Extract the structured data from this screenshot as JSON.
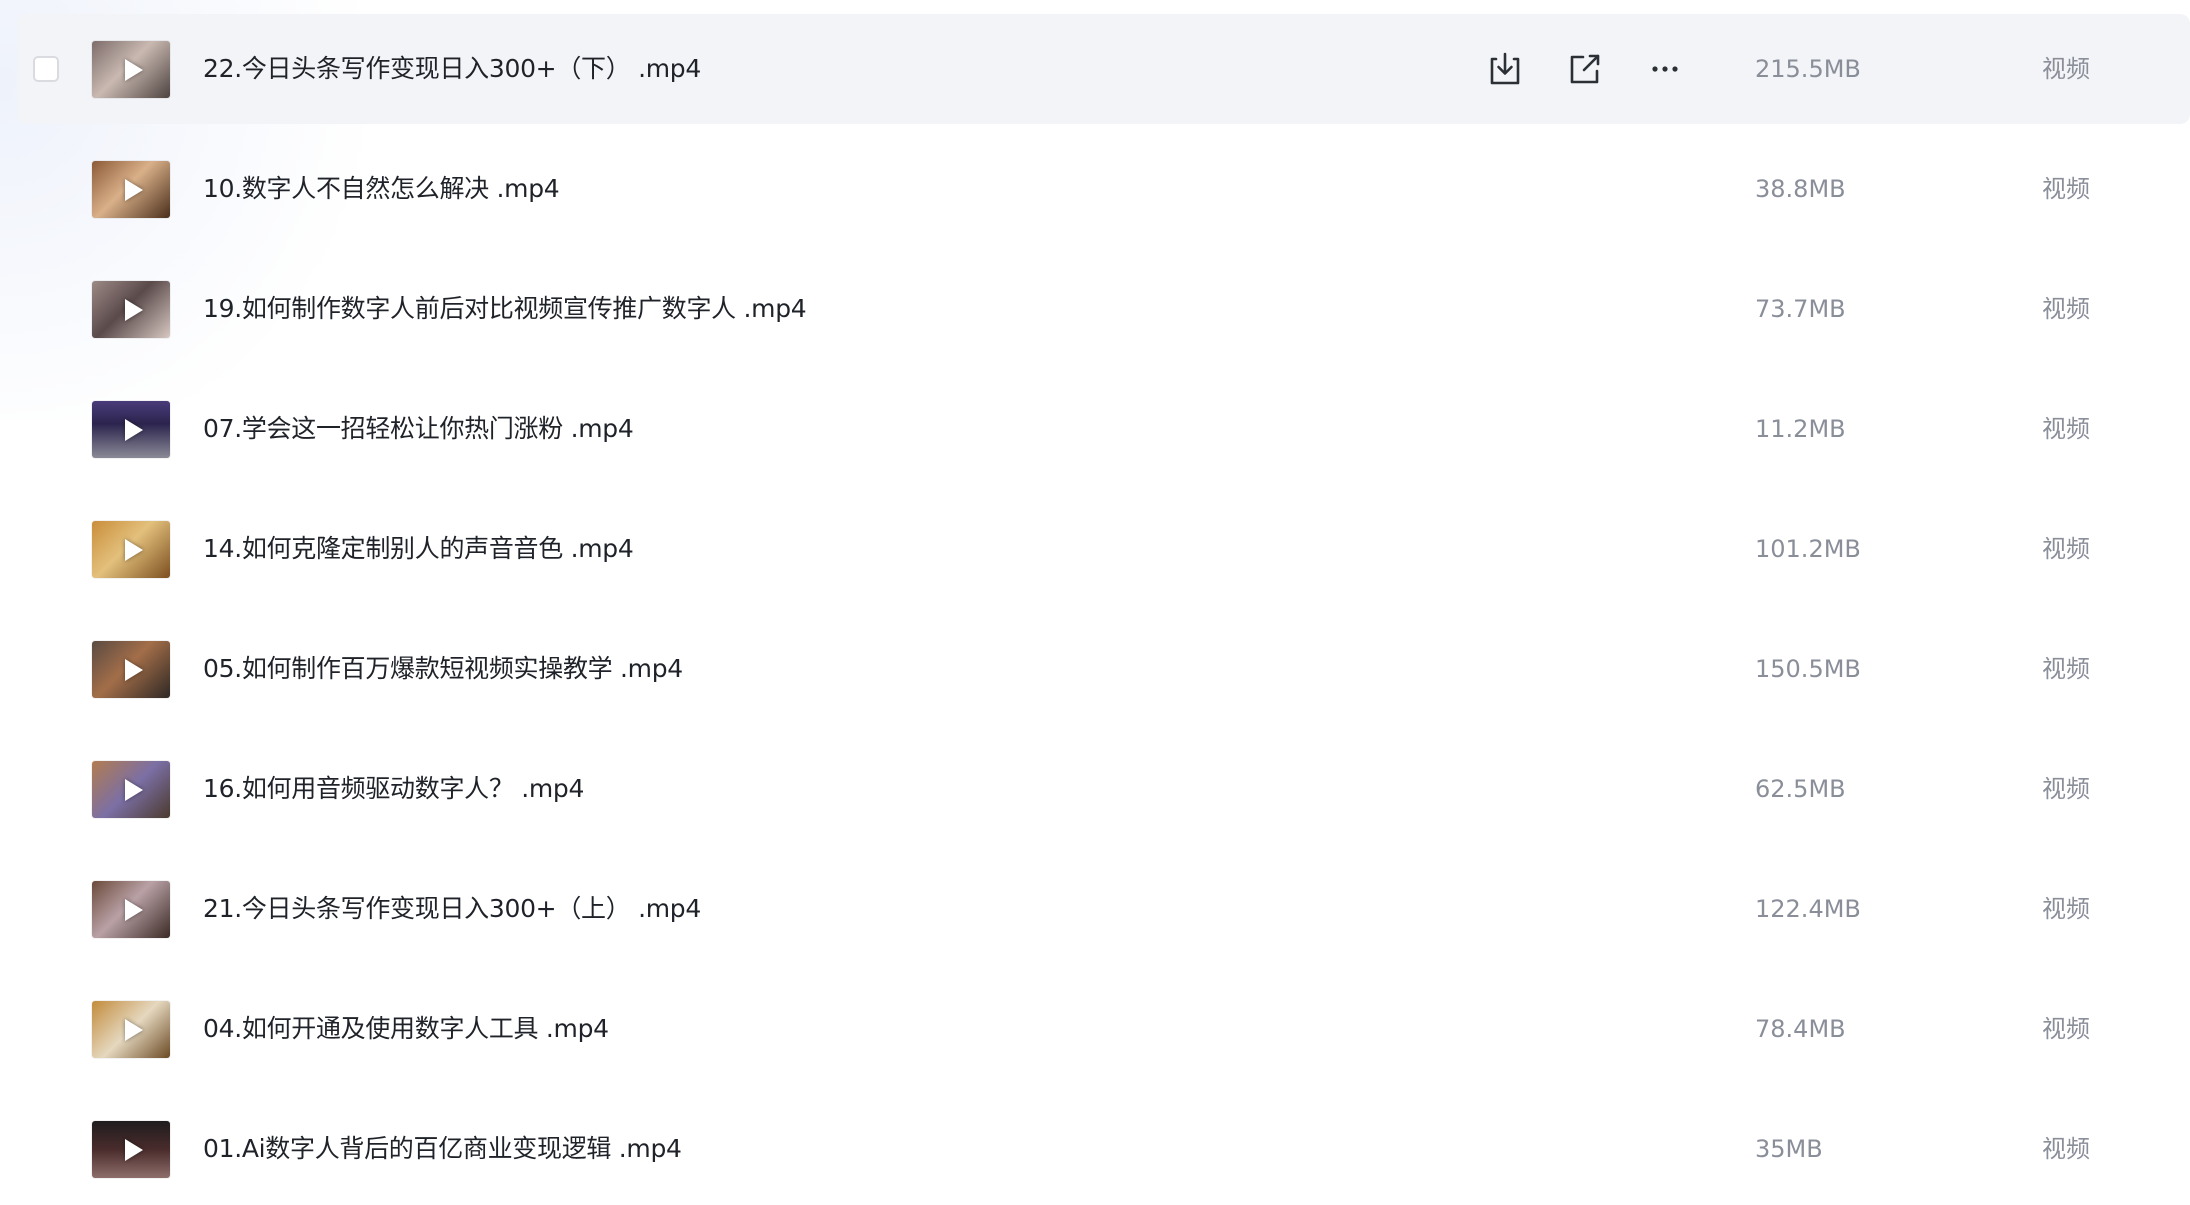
{
  "files": [
    {
      "name": "22.今日头条写作变现日入300+（下） .mp4",
      "size": "215.5MB",
      "type": "视频",
      "thumb_icon": "video-thumbnail",
      "hovered": true
    },
    {
      "name": "10.数字人不自然怎么解决 .mp4",
      "size": "38.8MB",
      "type": "视频",
      "thumb_icon": "video-thumbnail"
    },
    {
      "name": "19.如何制作数字人前后对比视频宣传推广数字人 .mp4",
      "size": "73.7MB",
      "type": "视频",
      "thumb_icon": "video-thumbnail"
    },
    {
      "name": "07.学会这一招轻松让你热门涨粉 .mp4",
      "size": "11.2MB",
      "type": "视频",
      "thumb_icon": "video-thumbnail"
    },
    {
      "name": "14.如何克隆定制别人的声音音色 .mp4",
      "size": "101.2MB",
      "type": "视频",
      "thumb_icon": "video-thumbnail"
    },
    {
      "name": "05.如何制作百万爆款短视频实操教学 .mp4",
      "size": "150.5MB",
      "type": "视频",
      "thumb_icon": "video-thumbnail"
    },
    {
      "name": "16.如何用音频驱动数字人？ .mp4",
      "size": "62.5MB",
      "type": "视频",
      "thumb_icon": "video-thumbnail"
    },
    {
      "name": "21.今日头条写作变现日入300+（上） .mp4",
      "size": "122.4MB",
      "type": "视频",
      "thumb_icon": "video-thumbnail"
    },
    {
      "name": "04.如何开通及使用数字人工具 .mp4",
      "size": "78.4MB",
      "type": "视频",
      "thumb_icon": "video-thumbnail"
    },
    {
      "name": "01.Ai数字人背后的百亿商业变现逻辑 .mp4",
      "size": "35MB",
      "type": "视频",
      "thumb_icon": "video-thumbnail"
    }
  ],
  "row_actions": {
    "icons": [
      "download-icon",
      "share-icon",
      "more-icon"
    ]
  },
  "colors": {
    "text_primary": "#1f2329",
    "text_secondary": "#8a8e99",
    "hover_bg": "#f3f4f7",
    "icon": "#2b2f36"
  }
}
